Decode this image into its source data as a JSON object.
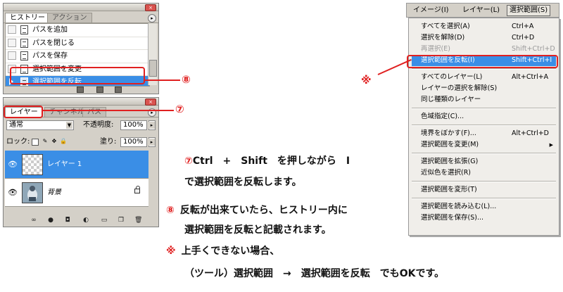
{
  "history_panel": {
    "tabs": [
      "ヒストリー",
      "アクション"
    ],
    "close_glyph": "×",
    "menu_arrow": "▸",
    "items": [
      "パスを追加",
      "パスを閉じる",
      "パスを保存",
      "選択範囲を変更",
      "選択範囲を反転"
    ],
    "selected_index": 4
  },
  "layers_panel": {
    "tabs": [
      "レイヤー",
      "チャンネル",
      "パス"
    ],
    "close_glyph": "×",
    "menu_arrow": "▸",
    "blend_mode": "通常",
    "opacity_label": "不透明度:",
    "opacity_value": "100%",
    "lock_label": "ロック:",
    "fill_label": "塗り:",
    "fill_value": "100%",
    "layers": [
      {
        "name": "レイヤー 1",
        "selected": true,
        "eye": "👁"
      },
      {
        "name": "背景",
        "selected": false,
        "eye": "👁",
        "locked": true
      }
    ],
    "bottom_icons": [
      "link-icon",
      "fx-icon",
      "mask-icon",
      "adjustment-icon",
      "group-icon",
      "new-layer-icon",
      "trash-icon"
    ]
  },
  "menu": {
    "bar_items": [
      "イメージ(I)",
      "レイヤー(L)",
      "選択範囲(S)"
    ],
    "open_index": 2,
    "items": [
      {
        "label": "すべてを選択(A)",
        "shortcut": "Ctrl+A"
      },
      {
        "label": "選択を解除(D)",
        "shortcut": "Ctrl+D"
      },
      {
        "label": "再選択(E)",
        "shortcut": "Shift+Ctrl+D",
        "disabled": true
      },
      {
        "label": "選択範囲を反転(I)",
        "shortcut": "Shift+Ctrl+I",
        "highlighted": true
      },
      {
        "separator": true
      },
      {
        "label": "すべてのレイヤー(L)",
        "shortcut": "Alt+Ctrl+A"
      },
      {
        "label": "レイヤーの選択を解除(S)",
        "shortcut": ""
      },
      {
        "label": "同じ種類のレイヤー",
        "shortcut": ""
      },
      {
        "separator": true
      },
      {
        "label": "色域指定(C)...",
        "shortcut": ""
      },
      {
        "separator": true
      },
      {
        "label": "境界をぼかす(F)...",
        "shortcut": "Alt+Ctrl+D"
      },
      {
        "label": "選択範囲を変更(M)",
        "shortcut": "",
        "submenu": true
      },
      {
        "separator": true
      },
      {
        "label": "選択範囲を拡張(G)",
        "shortcut": ""
      },
      {
        "label": "近似色を選択(R)",
        "shortcut": ""
      },
      {
        "separator": true
      },
      {
        "label": "選択範囲を変形(T)",
        "shortcut": ""
      },
      {
        "separator": true
      },
      {
        "label": "選択範囲を読み込む(L)...",
        "shortcut": ""
      },
      {
        "label": "選択範囲を保存(S)...",
        "shortcut": ""
      }
    ]
  },
  "annotations": {
    "mark_8": "⑧",
    "mark_7": "⑦",
    "mark_note": "※",
    "line1_mark": "⑦",
    "line1_text": "Ctrl　+　Shift　を押しながら　I",
    "line2_text": "で選択範囲を反転します。",
    "line3_mark": "⑧",
    "line3_text": "反転が出来ていたら、ヒストリー内に",
    "line4_text": "選択範囲を反転と記載されます。",
    "line5_mark": "※",
    "line5_text": "上手くできない場合、",
    "line6_text": "（ツール）選択範囲　→　選択範囲を反転　でもOKです。",
    "accent_color": "#e02020",
    "highlight_color": "#3a8ee6"
  }
}
